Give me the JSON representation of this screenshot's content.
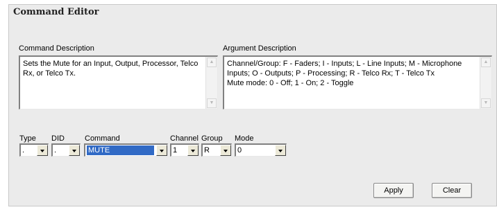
{
  "window": {
    "title": "Command Editor"
  },
  "command_description": {
    "label": "Command Description",
    "text": "Sets the Mute for an Input, Output, Processor, Telco Rx, or Telco Tx."
  },
  "argument_description": {
    "label": "Argument Description",
    "text": "Channel/Group: F - Faders; I - Inputs; L - Line Inputs; M - Microphone Inputs; O - Outputs; P - Processing; R - Telco Rx; T - Telco Tx\nMute mode: 0 - Off; 1 - On; 2 - Toggle"
  },
  "fields": {
    "type": {
      "label": "Type",
      "value": "."
    },
    "did": {
      "label": "DID",
      "value": "."
    },
    "command": {
      "label": "Command",
      "value": "MUTE"
    },
    "channel": {
      "label": "Channel",
      "value": "1"
    },
    "group": {
      "label": "Group",
      "value": "R"
    },
    "mode": {
      "label": "Mode",
      "value": "0"
    }
  },
  "buttons": {
    "apply": "Apply",
    "clear": "Clear"
  },
  "icons": {
    "scroll_up": "scroll-up-arrow-icon",
    "scroll_down": "scroll-down-arrow-icon",
    "dropdown": "chevron-down-icon"
  },
  "colors": {
    "panel": "#ebebeb",
    "selection": "#316ac5"
  }
}
